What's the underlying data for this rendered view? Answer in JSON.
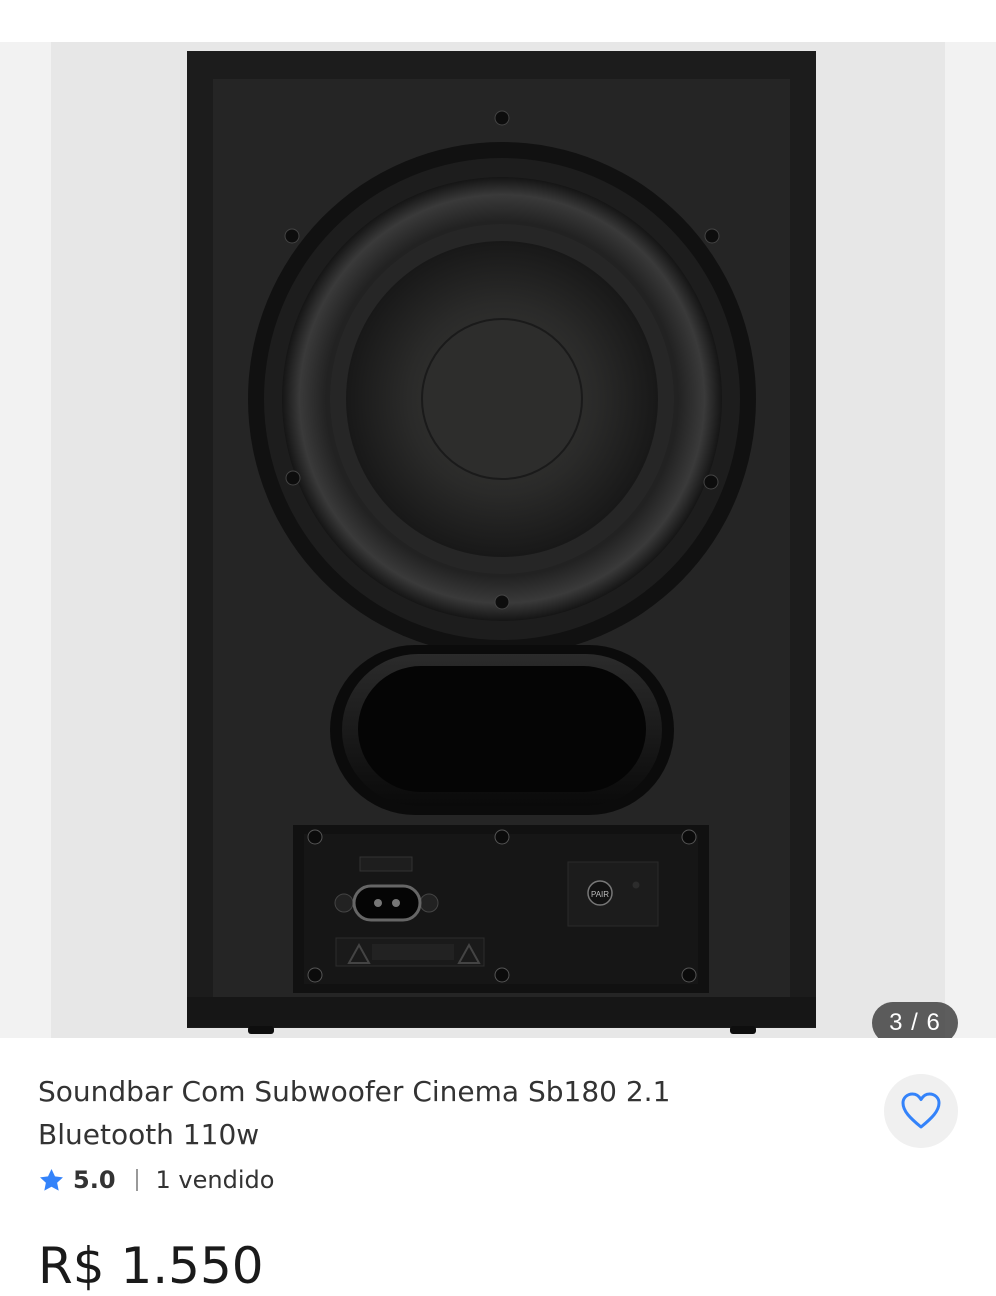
{
  "gallery": {
    "counter_text": "3 / 6",
    "current_index": 3,
    "total": 6,
    "panel_label": "PAIR"
  },
  "product": {
    "title": "Soundbar Com Subwoofer Cinema Sb180 2.1 Bluetooth 110w",
    "rating": "5.0",
    "sold_text": "1 vendido",
    "price": "R$ 1.550"
  },
  "colors": {
    "star": "#3483fa",
    "heart": "#3483fa",
    "text": "#333333"
  },
  "icons": {
    "rating": "star-icon",
    "favorite": "heart-icon"
  }
}
